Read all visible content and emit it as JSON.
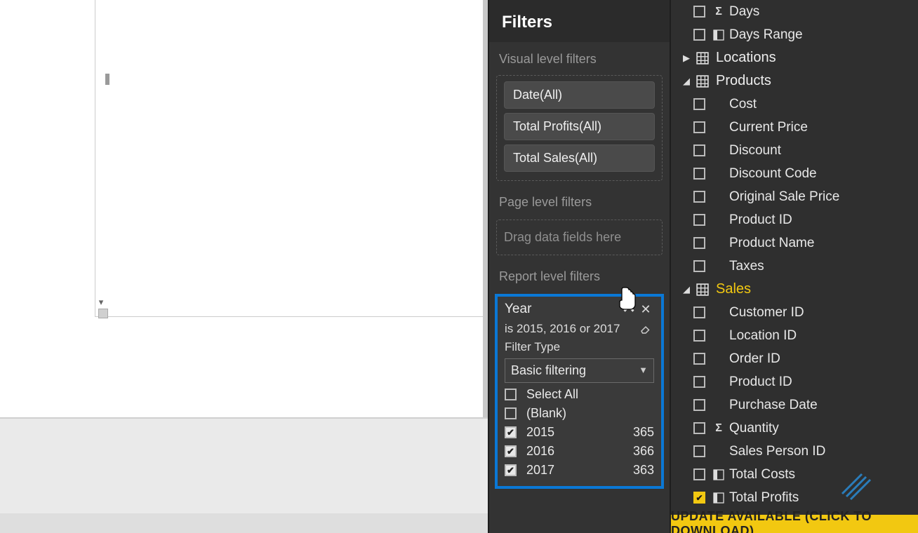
{
  "filters": {
    "title": "Filters",
    "visual_label": "Visual level filters",
    "visual_items": [
      {
        "label": "Date(All)"
      },
      {
        "label": "Total Profits(All)"
      },
      {
        "label": "Total Sales(All)"
      }
    ],
    "page_label": "Page level filters",
    "page_drop": "Drag data fields here",
    "report_label": "Report level filters",
    "year_card": {
      "title": "Year",
      "summary": "is 2015, 2016 or 2017",
      "filter_type_label": "Filter Type",
      "filter_type_value": "Basic filtering",
      "select_all": "Select All",
      "blank": "(Blank)",
      "rows": [
        {
          "label": "2015",
          "count": "365",
          "checked": true
        },
        {
          "label": "2016",
          "count": "366",
          "checked": true
        },
        {
          "label": "2017",
          "count": "363",
          "checked": true
        }
      ]
    }
  },
  "fields": {
    "top_leftover": [
      {
        "label": "Days",
        "sigma": true
      },
      {
        "label": "Days Range",
        "column": true
      }
    ],
    "tables": [
      {
        "name": "Locations",
        "expanded": false
      },
      {
        "name": "Products",
        "expanded": true,
        "fields": [
          {
            "label": "Cost"
          },
          {
            "label": "Current Price"
          },
          {
            "label": "Discount"
          },
          {
            "label": "Discount Code"
          },
          {
            "label": "Original Sale Price"
          },
          {
            "label": "Product ID"
          },
          {
            "label": "Product Name"
          },
          {
            "label": "Taxes"
          }
        ]
      },
      {
        "name": "Sales",
        "expanded": true,
        "highlighted": true,
        "fields": [
          {
            "label": "Customer ID"
          },
          {
            "label": "Location ID"
          },
          {
            "label": "Order ID"
          },
          {
            "label": "Product ID"
          },
          {
            "label": "Purchase Date"
          },
          {
            "label": "Quantity",
            "sigma": true
          },
          {
            "label": "Sales Person ID"
          },
          {
            "label": "Total Costs",
            "column": true
          },
          {
            "label": "Total Profits",
            "column": true,
            "checked": true
          }
        ]
      }
    ]
  },
  "update_bar": "UPDATE AVAILABLE (CLICK TO DOWNLOAD)"
}
